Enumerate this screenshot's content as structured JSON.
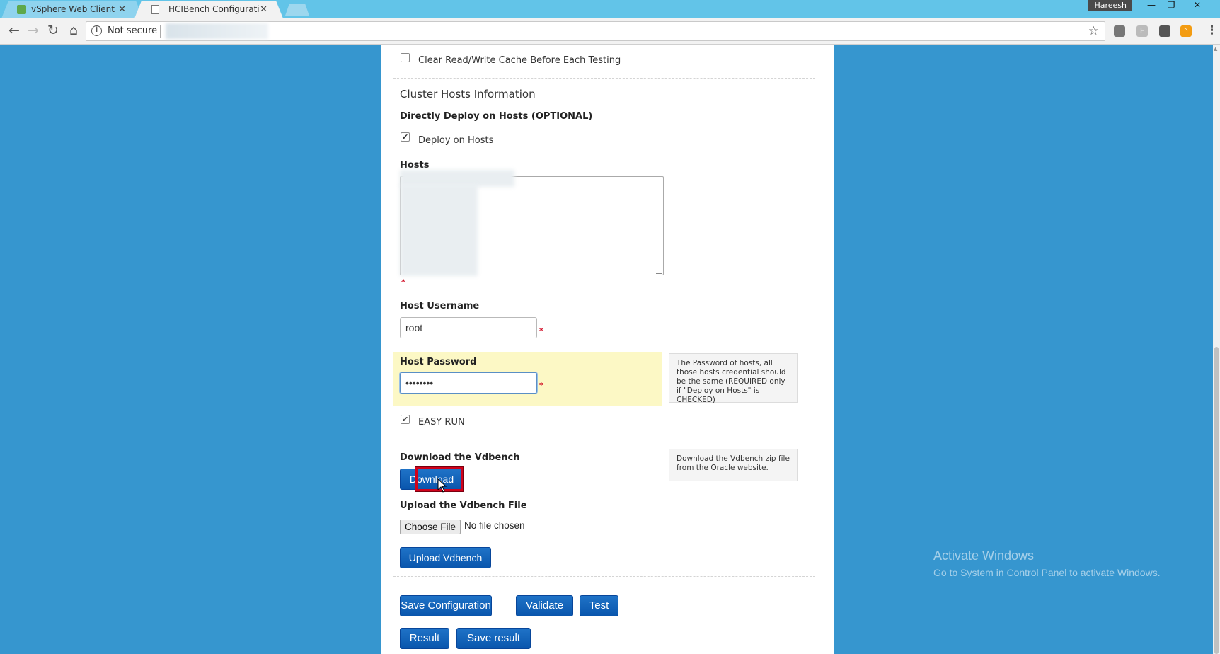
{
  "browser": {
    "tabs": [
      {
        "label": "vSphere Web Client",
        "active": false
      },
      {
        "label": "HCIBench Configuration",
        "active": true
      }
    ],
    "user": "Hareesh",
    "window_controls": {
      "minimize": "—",
      "maximize": "❐",
      "close": "✕"
    },
    "address": {
      "security_text": "Not secure"
    }
  },
  "form": {
    "clear_cache": {
      "label": "Clear Read/Write Cache Before Each Testing",
      "checked": false
    },
    "cluster_hosts_title": "Cluster Hosts Information",
    "directly_deploy_label": "Directly Deploy on Hosts (OPTIONAL)",
    "deploy_on_hosts": {
      "label": "Deploy on Hosts",
      "checked": true
    },
    "hosts_label": "Hosts",
    "required_mark": "*",
    "host_username": {
      "label": "Host Username",
      "value": "root"
    },
    "host_password": {
      "label": "Host Password",
      "value": "••••••••",
      "help": "The Password of hosts, all those hosts credential should be the same (REQUIRED only if \"Deploy on Hosts\" is CHECKED)"
    },
    "easy_run": {
      "label": "EASY RUN",
      "checked": true
    },
    "download_vdbench": {
      "label": "Download the Vdbench",
      "button": "Download",
      "help": "Download the Vdbench zip file from the Oracle website."
    },
    "upload_vdbench": {
      "label": "Upload the Vdbench File",
      "choose_file": "Choose File",
      "file_status": "No file chosen",
      "button": "Upload Vdbench"
    },
    "actions": {
      "save": "Save Configuration",
      "validate": "Validate",
      "test": "Test",
      "result": "Result",
      "save_result": "Save result"
    }
  },
  "watermark": {
    "title": "Activate Windows",
    "subtitle": "Go to System in Control Panel to activate Windows."
  },
  "colors": {
    "page_bg": "#3696cf",
    "button": "#0a56ad",
    "highlight": "#fcf8c5",
    "required": "#d0021b",
    "annotation": "#d0021b"
  }
}
